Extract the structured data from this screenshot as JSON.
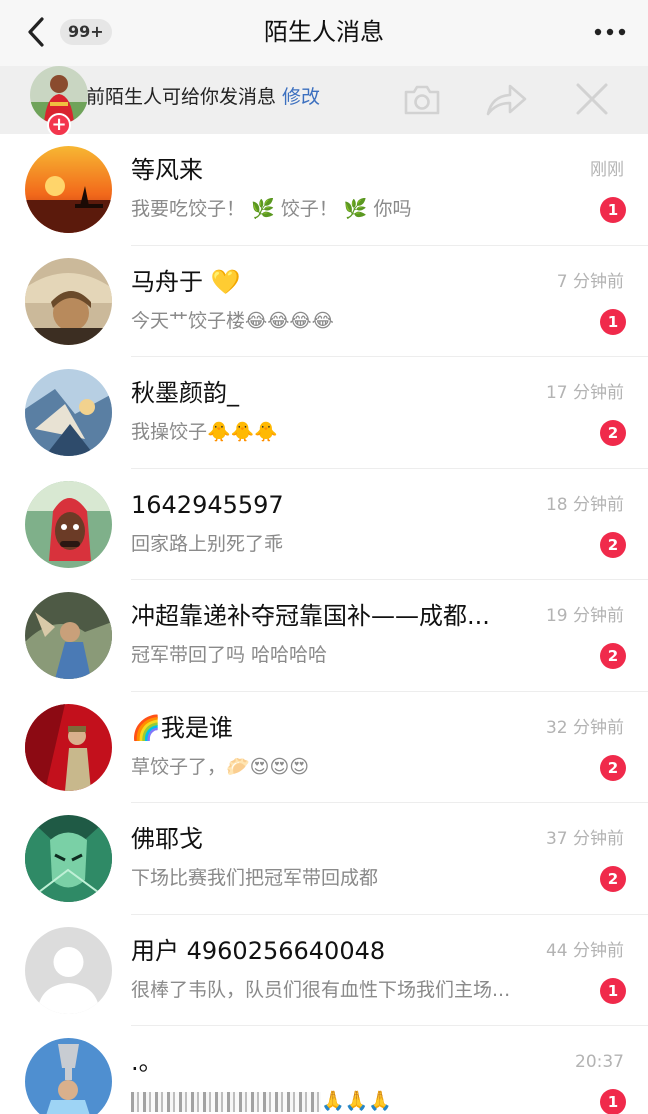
{
  "nav": {
    "title": "陌生人消息",
    "badge": "99+",
    "back_icon": "chevron-left-icon",
    "more_icon": "more-dots-icon"
  },
  "banner": {
    "text": "前陌生人可给你发消息",
    "edit_label": "修改",
    "plus": "+",
    "camera_icon": "camera-icon",
    "share_icon": "share-arrow-icon",
    "close_icon": "close-icon"
  },
  "colors": {
    "badge_red": "#f02a4b",
    "link_blue": "#3b6fbf",
    "time_gray": "#b3b3b3",
    "preview_gray": "#8a8a8a"
  },
  "messages": [
    {
      "name": "等风来",
      "time": "刚刚",
      "preview": "我要吃饺子！ 🌿 饺子！ 🌿 你吗",
      "unread": "1"
    },
    {
      "name": "马舟于 💛",
      "time": "7 分钟前",
      "preview": "今天艹饺子楼😂😂😂😂",
      "unread": "1"
    },
    {
      "name": "秋墨颜韵_",
      "time": "17 分钟前",
      "preview": "我操饺子🐥🐥🐥",
      "unread": "2"
    },
    {
      "name": "1642945597",
      "time": "18 分钟前",
      "preview": "回家路上别死了乖",
      "unread": "2"
    },
    {
      "name": "冲超靠递补夺冠靠国补——成都...",
      "time": "19 分钟前",
      "preview": "冠军带回了吗 哈哈哈哈",
      "unread": "2"
    },
    {
      "name": "🌈我是谁",
      "time": "32 分钟前",
      "preview": "草饺子了，🥟😍😍😍",
      "unread": "2"
    },
    {
      "name": "佛耶戈",
      "time": "37 分钟前",
      "preview": "下场比赛我们把冠军带回成都",
      "unread": "2"
    },
    {
      "name": "用户 4960256640048",
      "time": "44 分钟前",
      "preview": "很棒了韦队，队员们很有血性下场我们主场...",
      "unread": "1"
    },
    {
      "name": ".。",
      "time": "20:37",
      "preview": "🙏🙏🙏",
      "unread": "1"
    }
  ]
}
